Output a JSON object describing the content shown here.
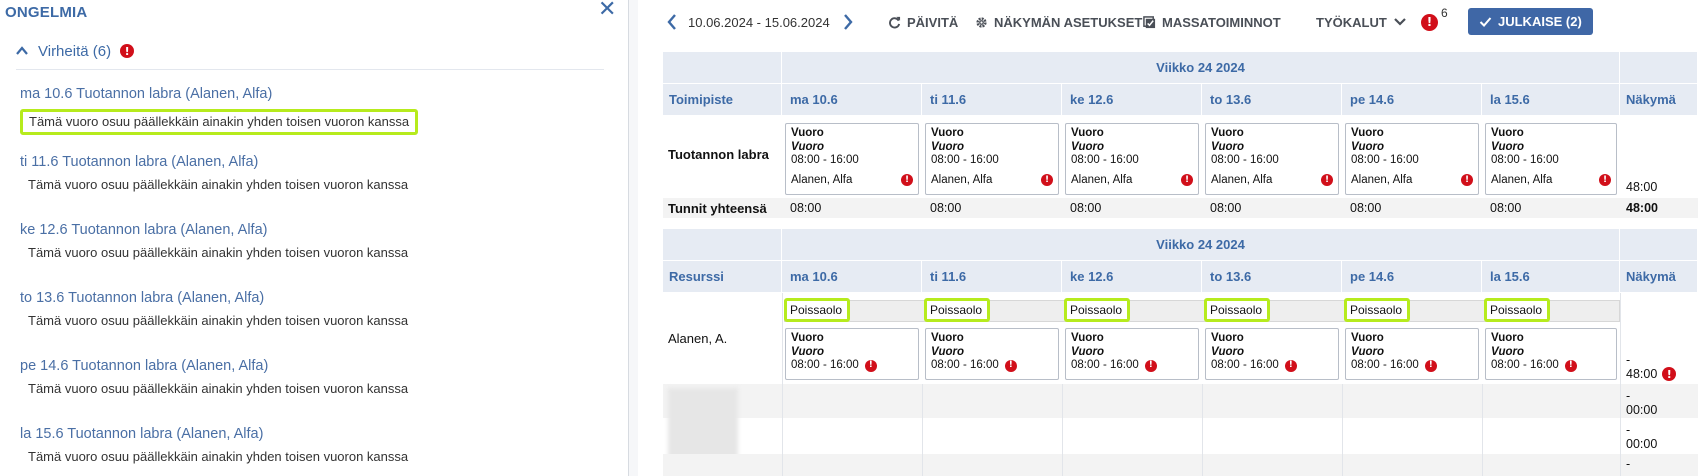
{
  "left_panel": {
    "title": "ONGELMIA",
    "errors_title": "Virheitä (6)",
    "items": [
      {
        "title": "ma 10.6 Tuotannon labra (Alanen, Alfa)",
        "message": "Tämä vuoro osuu päällekkäin ainakin yhden toisen vuoron kanssa"
      },
      {
        "title": "ti 11.6 Tuotannon labra (Alanen, Alfa)",
        "message": "Tämä vuoro osuu päällekkäin ainakin yhden toisen vuoron kanssa"
      },
      {
        "title": "ke 12.6 Tuotannon labra (Alanen, Alfa)",
        "message": "Tämä vuoro osuu päällekkäin ainakin yhden toisen vuoron kanssa"
      },
      {
        "title": "to 13.6 Tuotannon labra (Alanen, Alfa)",
        "message": "Tämä vuoro osuu päällekkäin ainakin yhden toisen vuoron kanssa"
      },
      {
        "title": "pe 14.6 Tuotannon labra (Alanen, Alfa)",
        "message": "Tämä vuoro osuu päällekkäin ainakin yhden toisen vuoron kanssa"
      },
      {
        "title": "la 15.6 Tuotannon labra (Alanen, Alfa)",
        "message": "Tämä vuoro osuu päällekkäin ainakin yhden toisen vuoron kanssa"
      }
    ]
  },
  "toolbar": {
    "date_range": "10.06.2024 - 15.06.2024",
    "refresh": "PÄIVITÄ",
    "view_settings": "NÄKYMÄN ASETUKSET",
    "bulk_actions": "MASSATOIMINNOT",
    "tools": "TYÖKALUT",
    "alert_count": "6",
    "publish": "JULKAISE (2)"
  },
  "days": [
    "ma 10.6",
    "ti 11.6",
    "ke 12.6",
    "to 13.6",
    "pe 14.6",
    "la 15.6"
  ],
  "location_table": {
    "week_title": "Viikko 24 2024",
    "first_col_header": "Toimipiste",
    "last_col_header": "Näkymä",
    "row_label": "Tuotannon labra",
    "shift": {
      "type": "Vuoro",
      "subtype": "Vuoro",
      "time": "08:00 - 16:00",
      "person": "Alanen, Alfa"
    },
    "row_total": "48:00",
    "totals_label": "Tunnit yhteensä",
    "day_totals": [
      "08:00",
      "08:00",
      "08:00",
      "08:00",
      "08:00",
      "08:00"
    ],
    "grand_total": "48:00"
  },
  "resource_table": {
    "week_title": "Viikko 24 2024",
    "first_col_header": "Resurssi",
    "last_col_header": "Näkymä",
    "row_label": "Alanen, A.",
    "absence_label": "Poissaolo",
    "shift": {
      "type": "Vuoro",
      "subtype": "Vuoro",
      "time": "08:00 - 16:00"
    },
    "row_total_dash": "-",
    "row_total": "48:00",
    "extra_rows": [
      {
        "dash": "-",
        "total": "00:00"
      },
      {
        "dash": "-",
        "total": "00:00"
      },
      {
        "dash": "-",
        "total": ""
      }
    ]
  },
  "colors": {
    "accent": "#3f67a6",
    "header_bg": "#e6ebf3",
    "error_red": "#d10f1a",
    "highlight": "#b6eb1d"
  },
  "icons": [
    "close-icon",
    "chevron-up-icon",
    "error-icon",
    "chevron-left-icon",
    "chevron-right-icon",
    "refresh-icon",
    "gear-icon",
    "checklist-icon",
    "chevron-down-icon",
    "check-icon"
  ]
}
